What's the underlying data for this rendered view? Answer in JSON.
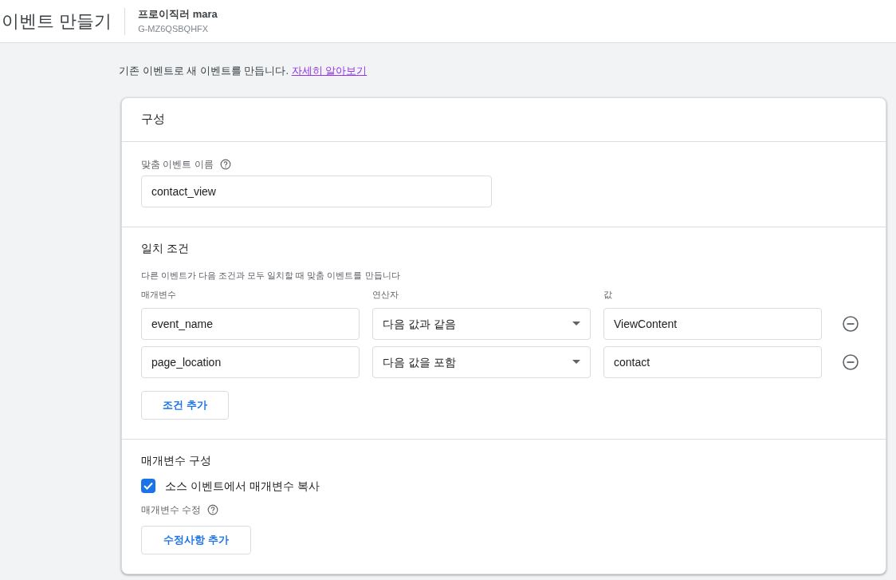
{
  "header": {
    "title": "이벤트 만들기",
    "property_name": "프로이직러 mara",
    "property_id": "G-MZ6QSBQHFX"
  },
  "intro": {
    "text": "기존 이벤트로 새 이벤트를 만듭니다.",
    "link": "자세히 알아보기"
  },
  "card": {
    "title": "구성",
    "custom_event": {
      "label": "맞춤 이벤트 이름",
      "value": "contact_view"
    },
    "conditions": {
      "title": "일치 조건",
      "description": "다른 이벤트가 다음 조건과 모두 일치할 때 맞춤 이벤트를 만듭니다",
      "columns": [
        "매개변수",
        "연산자",
        "값"
      ],
      "rows": [
        {
          "parameter": "event_name",
          "operator": "다음 값과 같음",
          "value": "ViewContent"
        },
        {
          "parameter": "page_location",
          "operator": "다음 값을 포함",
          "value": "contact"
        }
      ],
      "add_button": "조건 추가"
    },
    "parameters": {
      "title": "매개변수 구성",
      "copy_checkbox": {
        "label": "소스 이벤트에서 매개변수 복사",
        "checked": true
      },
      "modify_label": "매개변수 수정",
      "add_button": "수정사항 추가"
    }
  }
}
